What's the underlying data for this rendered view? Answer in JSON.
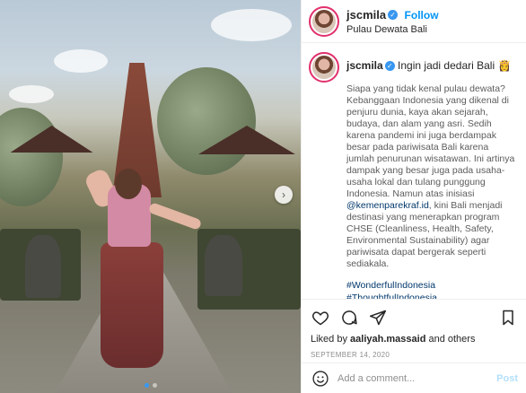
{
  "post": {
    "username": "jscmila",
    "follow_label": "Follow",
    "location": "Pulau Dewata Bali",
    "verified_mark": "✓"
  },
  "caption": {
    "username": "jscmila",
    "headline": "Ingin jadi dedari Bali 👸",
    "text_1": "Siapa yang tidak kenal pulau dewata? Kebanggaan Indonesia yang dikenal di penjuru dunia, kaya akan sejarah, budaya, dan alam yang asri. Sedih karena pandemi ini juga berdampak besar pada pariwisata Bali karena jumlah penurunan wisatawan. Ini artinya dampak yang besar juga pada usaha-usaha lokal dan tulang punggung Indonesia. Namun atas inisiasi ",
    "mention": "@kemenparekraf.id",
    "text_2": ", kini Bali menjadi destinasi yang menerapkan program CHSE (Cleanliness, Health, Safety, Environmental Sustainability) agar pariwisata dapat bergerak seperti sediakala.",
    "hashtag_1": "#WonderfulIndonesia",
    "hashtag_2": "#ThoughtfulIndonesia"
  },
  "actions": {
    "liked_prefix": "Liked by ",
    "liked_user": "aaliyah.massaid",
    "liked_suffix": " and others",
    "date": "SEPTEMBER 14, 2020"
  },
  "comment": {
    "placeholder": "Add a comment...",
    "post_label": "Post"
  },
  "carousel": {
    "next_glyph": "›",
    "total": 2,
    "active": 1
  },
  "colors": {
    "accent": "#0095f6",
    "verified": "#3897f0",
    "post_disabled": "#b2dffc",
    "link": "#00376b"
  }
}
